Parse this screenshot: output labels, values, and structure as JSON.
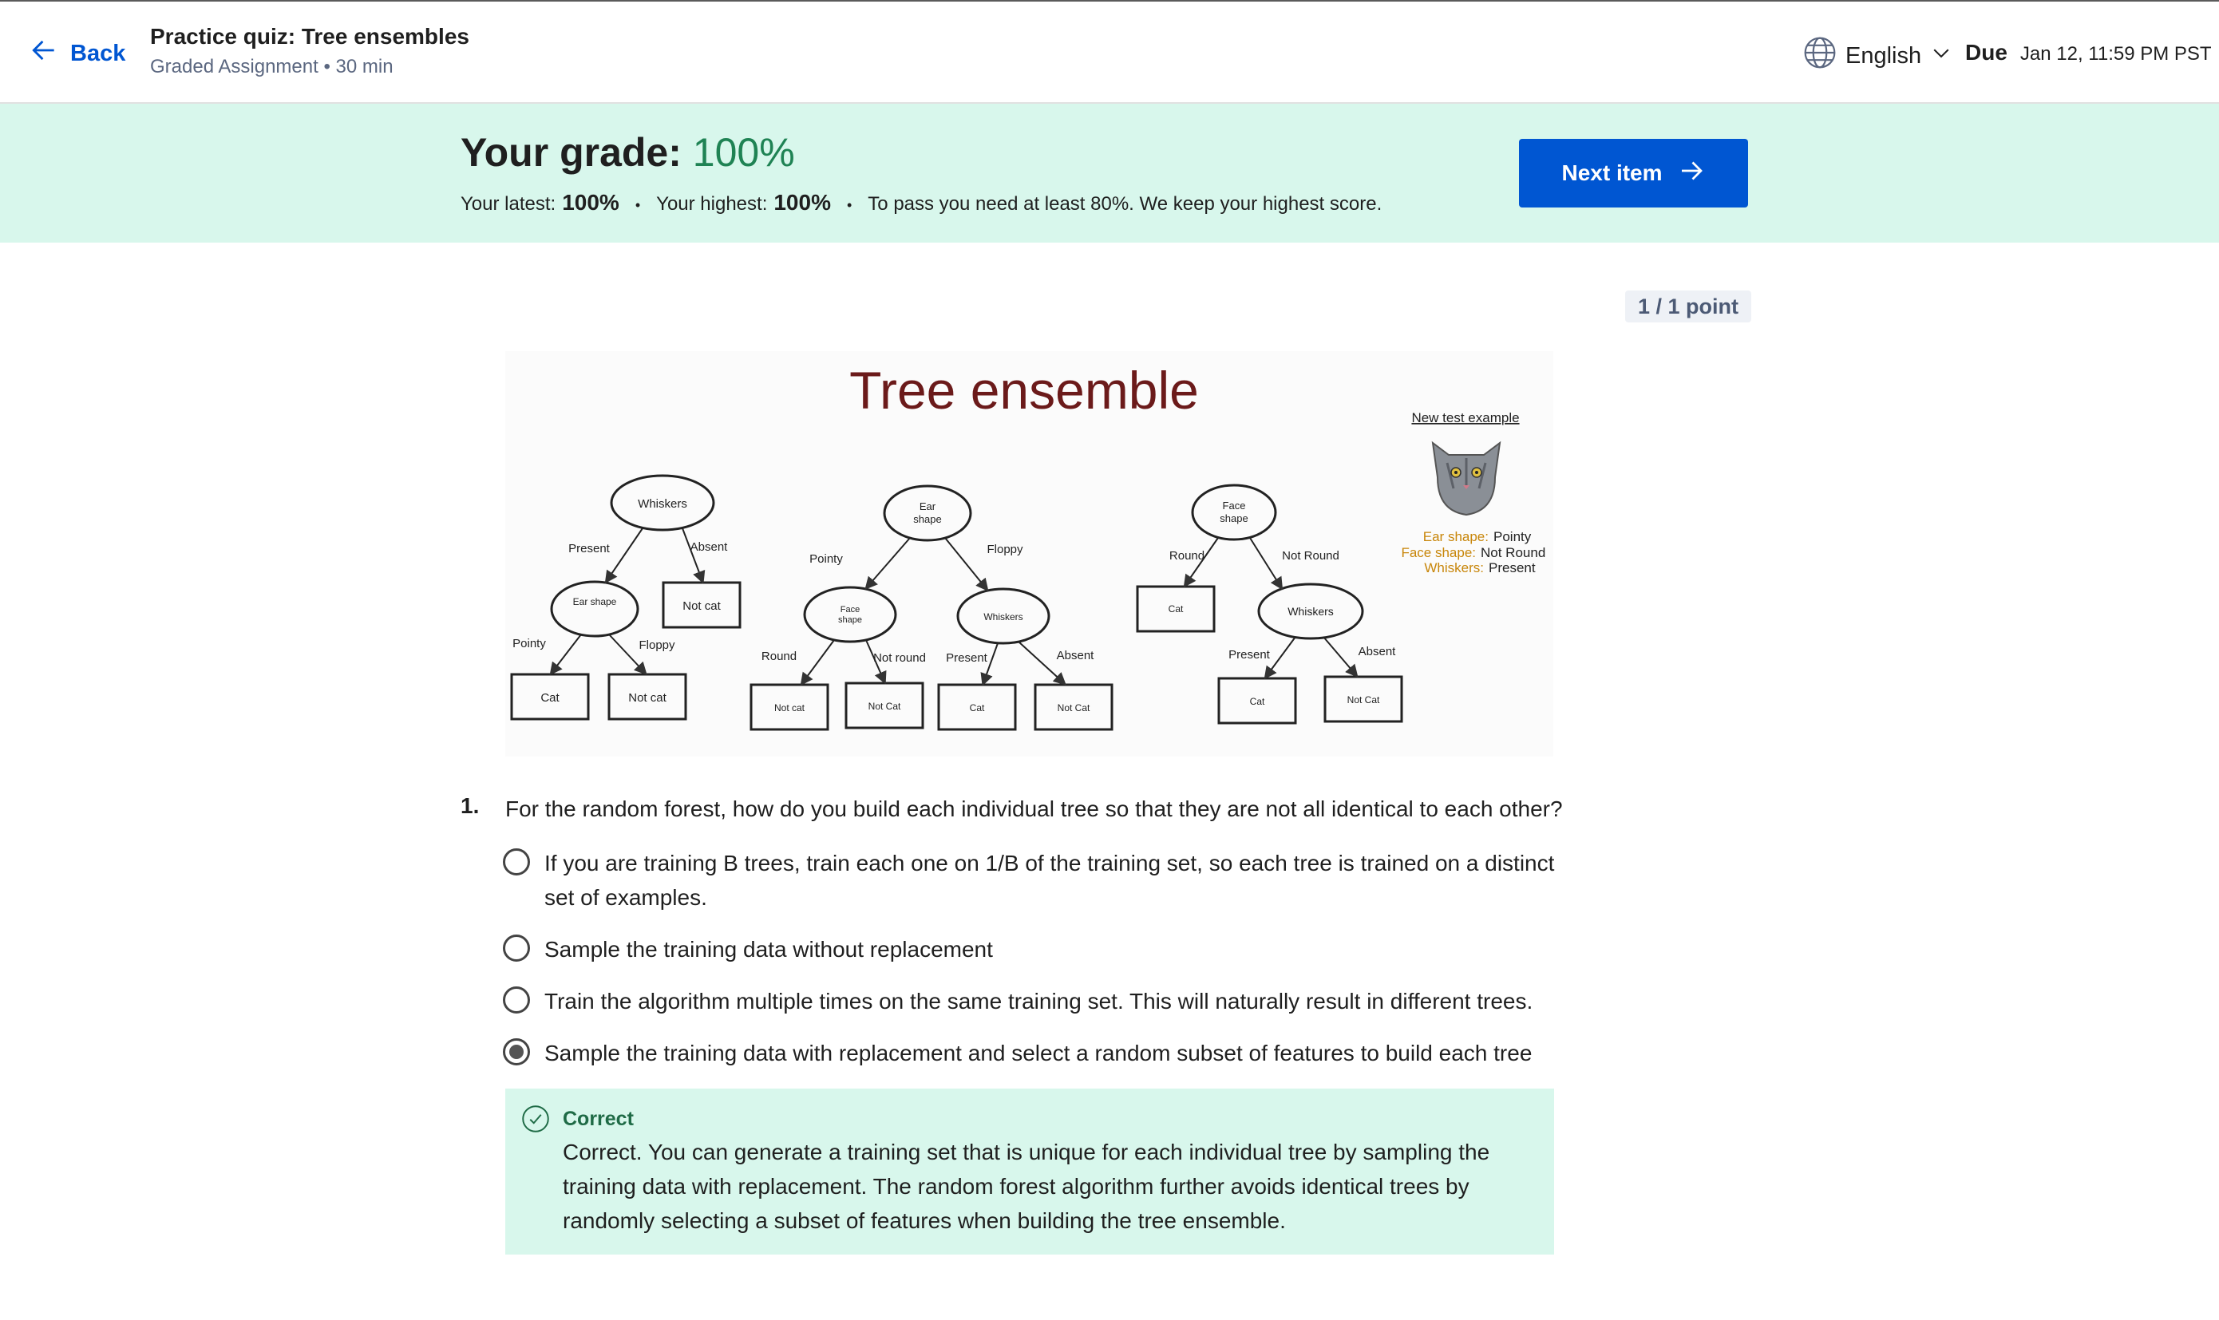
{
  "header": {
    "back_label": "Back",
    "title": "Practice quiz: Tree ensembles",
    "subtitle": "Graded Assignment • 30 min",
    "language": "English",
    "due_label": "Due",
    "due_value": "Jan 12, 11:59 PM PST"
  },
  "grade": {
    "label": "Your grade:",
    "value": "100%",
    "latest_label": "Your latest:",
    "latest_value": "100%",
    "highest_label": "Your highest:",
    "highest_value": "100%",
    "pass_note": "To pass you need at least 80%. We keep your highest score.",
    "next_label": "Next item"
  },
  "points": "1 / 1 point",
  "figure": {
    "title": "Tree ensemble",
    "new_example": "New test example",
    "attr_ear_label": "Ear shape:",
    "attr_ear_value": "Pointy",
    "attr_face_label": "Face shape:",
    "attr_face_value": "Not Round",
    "attr_whiskers_label": "Whiskers:",
    "attr_whiskers_value": "Present",
    "tree1": {
      "root": "Whiskers",
      "left_edge": "Present",
      "right_edge": "Absent",
      "mid_node": "Ear shape",
      "right_leaf": "Not cat",
      "ll_edge": "Pointy",
      "lr_edge": "Floppy",
      "leaf_a": "Cat",
      "leaf_b": "Not cat"
    },
    "tree2": {
      "root_line1": "Ear",
      "root_line2": "shape",
      "left_edge": "Pointy",
      "right_edge": "Floppy",
      "left_node_line1": "Face",
      "left_node_line2": "shape",
      "right_node": "Whiskers",
      "ll_edge": "Round",
      "lr_edge": "Not round",
      "rl_edge": "Present",
      "rr_edge": "Absent",
      "leaf_a": "Not cat",
      "leaf_b": "Not Cat",
      "leaf_c": "Cat",
      "leaf_d": "Not Cat"
    },
    "tree3": {
      "root_line1": "Face",
      "root_line2": "shape",
      "left_edge": "Round",
      "right_edge": "Not Round",
      "left_leaf": "Cat",
      "right_node": "Whiskers",
      "rl_edge": "Present",
      "rr_edge": "Absent",
      "leaf_a": "Cat",
      "leaf_b": "Not Cat"
    },
    "colors": {
      "title": "#6b1a1a",
      "attr_label": "#c8860a"
    }
  },
  "question": {
    "number": "1.",
    "text": "For the random forest, how do you build each individual tree so that they are not all identical to each other?",
    "options": [
      {
        "text": "If you are training B trees, train each one on 1/B of the training set, so each tree is trained on a distinct set of examples.",
        "selected": false
      },
      {
        "text": "Sample the training data without replacement",
        "selected": false
      },
      {
        "text": "Train the algorithm multiple times on the same training set. This will naturally result in different trees.",
        "selected": false
      },
      {
        "text": "Sample the training data with replacement and select a random subset of features to build each tree",
        "selected": true
      }
    ]
  },
  "feedback": {
    "status": "Correct",
    "text": "Correct.  You can generate a training set that is unique for each individual tree by sampling the training data with replacement. The random forest algorithm further avoids identical trees by randomly selecting a subset of features when building the tree ensemble."
  }
}
